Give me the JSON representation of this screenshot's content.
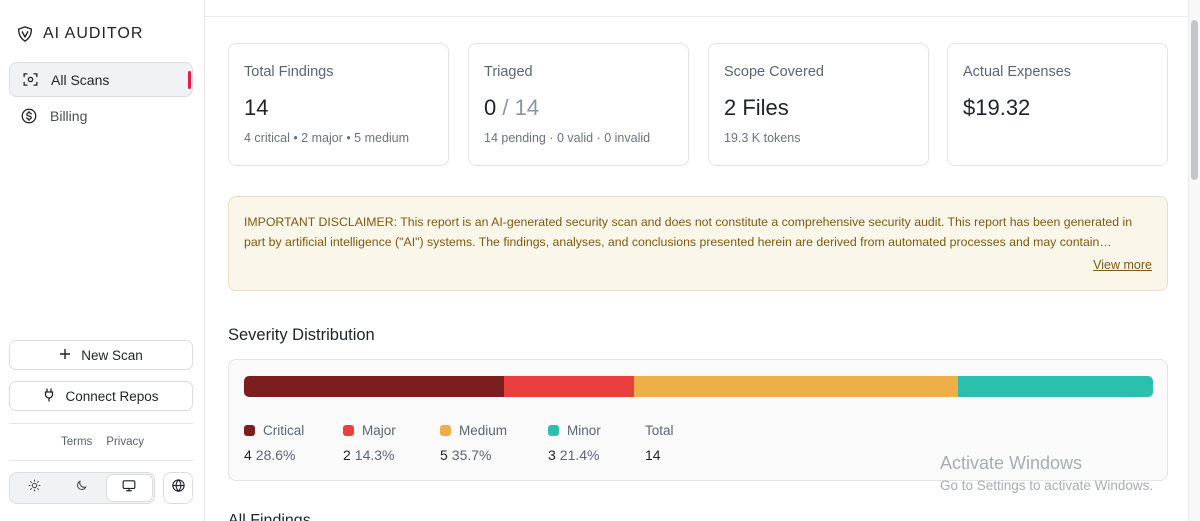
{
  "sidebar": {
    "brand": "AI AUDITOR",
    "nav": [
      {
        "label": "All Scans",
        "icon": "scan-icon",
        "active": true
      },
      {
        "label": "Billing",
        "icon": "dollar-icon",
        "active": false
      }
    ],
    "new_scan_label": "New Scan",
    "connect_repos_label": "Connect Repos",
    "terms_label": "Terms",
    "privacy_label": "Privacy",
    "theme_options": [
      "sun-icon",
      "moon-icon",
      "monitor-icon"
    ],
    "theme_selected": "monitor-icon"
  },
  "stats": {
    "total_findings": {
      "title": "Total Findings",
      "value": "14",
      "sub": "4 critical • 2 major • 5 medium"
    },
    "triaged": {
      "title": "Triaged",
      "value": "0",
      "value_total": "/ 14",
      "sub": "14 pending · 0 valid · 0 invalid"
    },
    "scope": {
      "title": "Scope Covered",
      "value": "2 Files",
      "sub": "19.3 K tokens"
    },
    "expenses": {
      "title": "Actual Expenses",
      "value": "$19.32"
    }
  },
  "disclaimer": {
    "text": "IMPORTANT DISCLAIMER: This report is an AI-generated security scan and does not constitute a comprehensive security audit. This report has been generated in part by artificial intelligence (\"AI\") systems. The findings, analyses, and conclusions presented herein are derived from automated processes and may contain inaccuracies, errors, or omissions.",
    "view_more_label": "View more"
  },
  "severity": {
    "title": "Severity Distribution",
    "items": [
      {
        "name": "Critical",
        "count": "4",
        "pct": "28.6%",
        "fraction": 0.286,
        "color": "#7b1e1e"
      },
      {
        "name": "Major",
        "count": "2",
        "pct": "14.3%",
        "fraction": 0.143,
        "color": "#ea3f3f"
      },
      {
        "name": "Medium",
        "count": "5",
        "pct": "35.7%",
        "fraction": 0.357,
        "color": "#efaf48"
      },
      {
        "name": "Minor",
        "count": "3",
        "pct": "21.4%",
        "fraction": 0.214,
        "color": "#2bbfae"
      }
    ],
    "total_label": "Total",
    "total_value": "14"
  },
  "watermark": {
    "line1": "Activate Windows",
    "line2": "Go to Settings to activate Windows."
  },
  "next_section": {
    "title": "All Findings"
  }
}
